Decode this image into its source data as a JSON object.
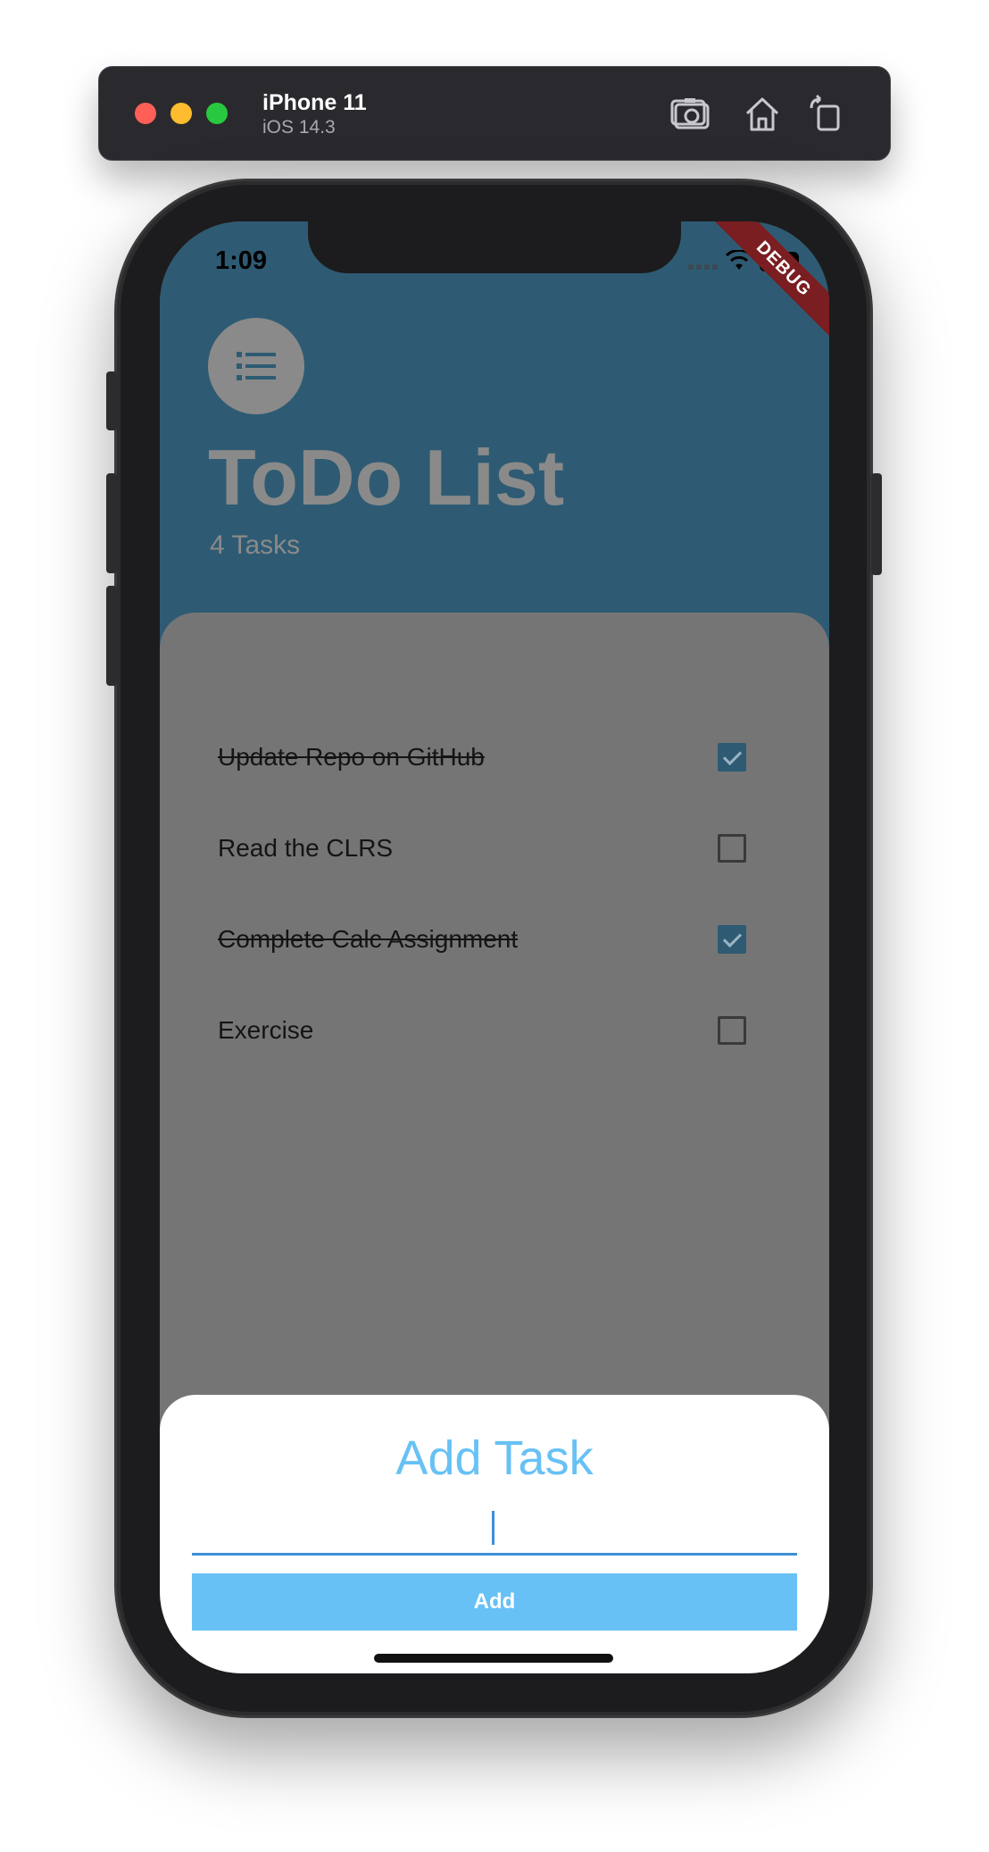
{
  "simulator": {
    "device_name": "iPhone 11",
    "os_version": "iOS 14.3",
    "toolbar_icons": [
      "screenshot-icon",
      "home-icon",
      "rotate-icon"
    ]
  },
  "status_bar": {
    "time": "1:09",
    "debug_banner": "DEBUG"
  },
  "app": {
    "title": "ToDo List",
    "task_count": "4 Tasks",
    "header_color": "#2e5b73",
    "menu_icon": "list-icon"
  },
  "tasks": [
    {
      "label": "Update Repo on GitHub",
      "done": true
    },
    {
      "label": "Read the CLRS",
      "done": false
    },
    {
      "label": "Complete Calc Assignment",
      "done": true
    },
    {
      "label": "Exercise",
      "done": false
    }
  ],
  "add_task_sheet": {
    "title": "Add Task",
    "input_value": "",
    "button_label": "Add",
    "accent_color": "#67c1f5"
  }
}
